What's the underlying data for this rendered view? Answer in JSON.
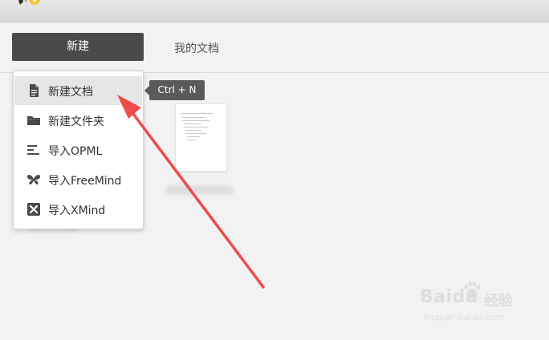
{
  "toolbar": {
    "new_label": "新建",
    "my_docs_label": "我的文档"
  },
  "menu": {
    "items": [
      {
        "label": "新建文档",
        "icon": "document-icon",
        "active": true
      },
      {
        "label": "新建文件夹",
        "icon": "folder-icon",
        "active": false
      },
      {
        "label": "导入OPML",
        "icon": "opml-icon",
        "active": false
      },
      {
        "label": "导入FreeMind",
        "icon": "butterfly-icon",
        "active": false
      },
      {
        "label": "导入XMind",
        "icon": "xmind-icon",
        "active": false
      }
    ]
  },
  "tooltip": {
    "shortcut": "Ctrl + N"
  },
  "watermark": {
    "brand": "Baidu",
    "cn": "经验",
    "url": "jingyan.baidu.com"
  },
  "colors": {
    "button_dark": "#4a4a4a",
    "menu_hover": "#e6e6e6",
    "arrow_red": "#f04a4a",
    "background": "#f2f2f2"
  }
}
